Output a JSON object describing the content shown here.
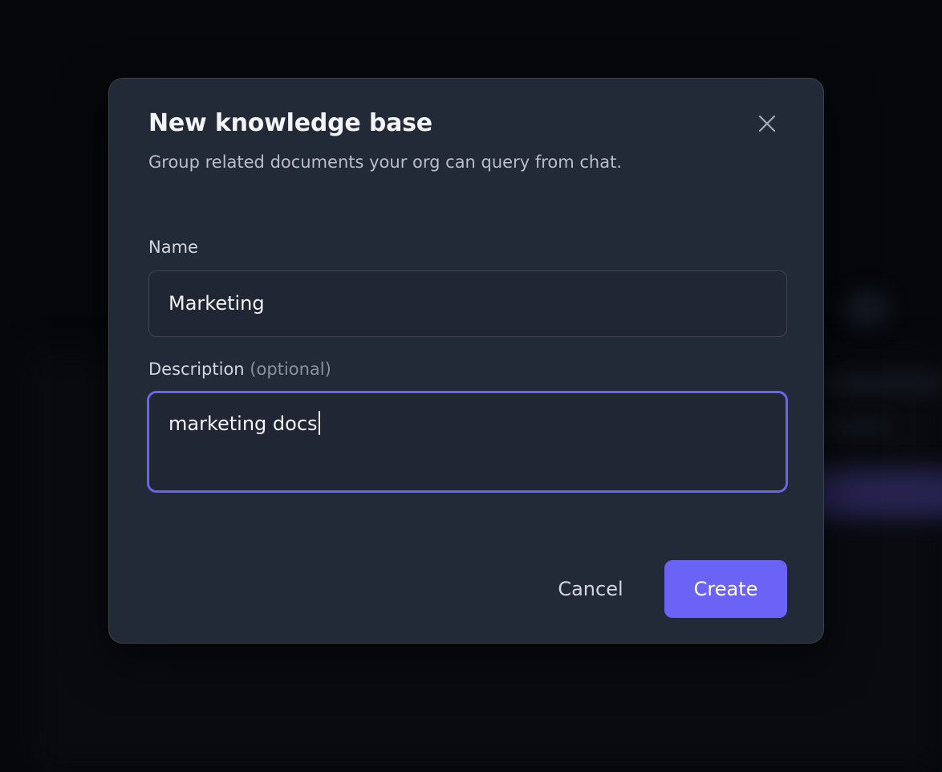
{
  "modal": {
    "title": "New knowledge base",
    "subtitle": "Group related documents your org can query from chat.",
    "close_icon": "close-icon"
  },
  "form": {
    "name": {
      "label": "Name",
      "value": "Marketing"
    },
    "description": {
      "label": "Description",
      "optional_label": "(optional)",
      "value": "marketing docs"
    }
  },
  "actions": {
    "cancel_label": "Cancel",
    "create_label": "Create"
  },
  "colors": {
    "accent": "#6b63f5",
    "focus_border": "#6a64e8",
    "modal_bg": "#222937",
    "page_bg": "#05070b"
  }
}
